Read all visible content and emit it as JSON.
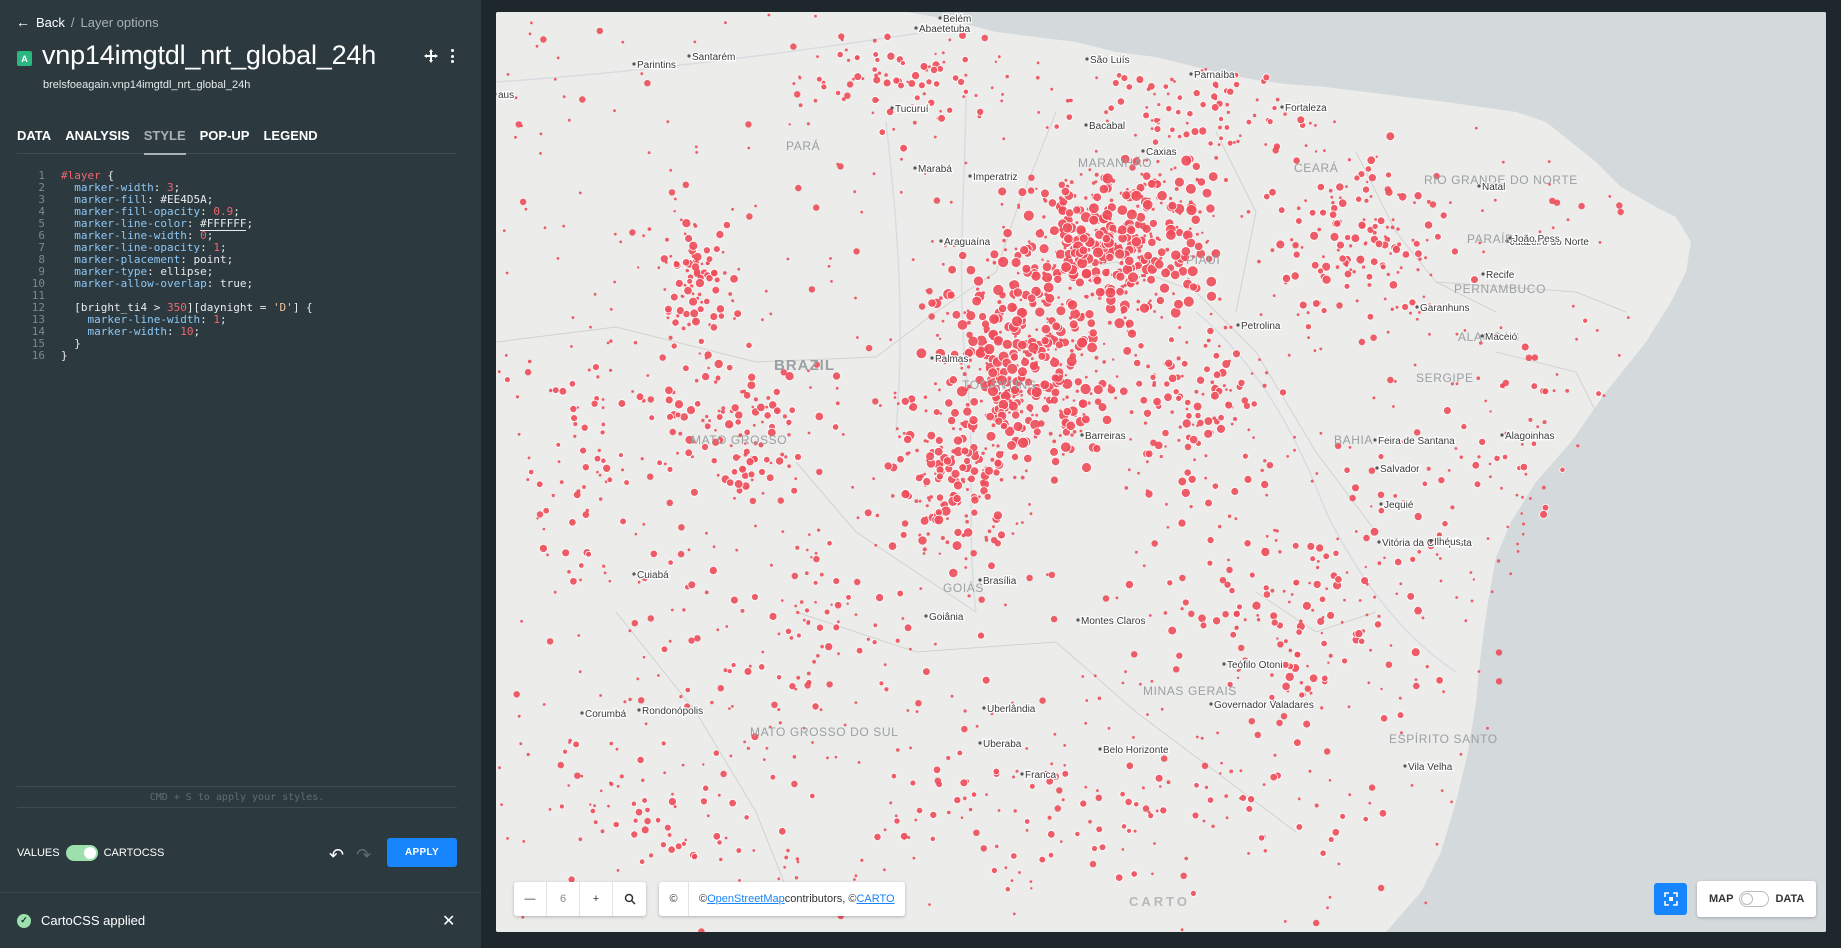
{
  "header": {
    "back_label": "Back",
    "breadcrumb": "Layer options",
    "layer_letter": "A",
    "layer_title": "vnp14imgtdl_nrt_global_24h",
    "layer_subtitle": "brelsfoeagain.vnp14imgtdl_nrt_global_24h"
  },
  "tabs": [
    {
      "label": "DATA"
    },
    {
      "label": "ANALYSIS"
    },
    {
      "label": "STYLE",
      "active": true
    },
    {
      "label": "POP-UP"
    },
    {
      "label": "LEGEND"
    }
  ],
  "code": [
    {
      "n": "1",
      "t": [
        [
          "sel",
          "#layer"
        ],
        [
          "pun",
          " {"
        ]
      ]
    },
    {
      "n": "2",
      "t": [
        [
          "pun",
          "  "
        ],
        [
          "prop",
          "marker-width"
        ],
        [
          "pun",
          ": "
        ],
        [
          "num",
          "3"
        ],
        [
          "pun",
          ";"
        ]
      ]
    },
    {
      "n": "3",
      "t": [
        [
          "pun",
          "  "
        ],
        [
          "prop",
          "marker-fill"
        ],
        [
          "pun",
          ": "
        ],
        [
          "pun",
          "#EE4D5A"
        ],
        [
          "pun",
          ";"
        ]
      ]
    },
    {
      "n": "4",
      "t": [
        [
          "pun",
          "  "
        ],
        [
          "prop",
          "marker-fill-opacity"
        ],
        [
          "pun",
          ": "
        ],
        [
          "num",
          "0.9"
        ],
        [
          "pun",
          ";"
        ]
      ]
    },
    {
      "n": "5",
      "t": [
        [
          "pun",
          "  "
        ],
        [
          "prop",
          "marker-line-color"
        ],
        [
          "pun",
          ": "
        ],
        [
          "color",
          "#FFFFFF"
        ],
        [
          "pun",
          ";"
        ]
      ]
    },
    {
      "n": "6",
      "t": [
        [
          "pun",
          "  "
        ],
        [
          "prop",
          "marker-line-width"
        ],
        [
          "pun",
          ": "
        ],
        [
          "num",
          "0"
        ],
        [
          "pun",
          ";"
        ]
      ]
    },
    {
      "n": "7",
      "t": [
        [
          "pun",
          "  "
        ],
        [
          "prop",
          "marker-line-opacity"
        ],
        [
          "pun",
          ": "
        ],
        [
          "num",
          "1"
        ],
        [
          "pun",
          ";"
        ]
      ]
    },
    {
      "n": "8",
      "t": [
        [
          "pun",
          "  "
        ],
        [
          "prop",
          "marker-placement"
        ],
        [
          "pun",
          ": point;"
        ]
      ]
    },
    {
      "n": "9",
      "t": [
        [
          "pun",
          "  "
        ],
        [
          "prop",
          "marker-type"
        ],
        [
          "pun",
          ": ellipse;"
        ]
      ]
    },
    {
      "n": "10",
      "t": [
        [
          "pun",
          "  "
        ],
        [
          "prop",
          "marker-allow-overlap"
        ],
        [
          "pun",
          ": true;"
        ]
      ]
    },
    {
      "n": "11",
      "t": []
    },
    {
      "n": "12",
      "t": [
        [
          "pun",
          "  [bright_ti4 > "
        ],
        [
          "num",
          "350"
        ],
        [
          "pun",
          "][daynight = "
        ],
        [
          "str",
          "'D'"
        ],
        [
          "pun",
          "] {"
        ]
      ]
    },
    {
      "n": "13",
      "t": [
        [
          "pun",
          "    "
        ],
        [
          "prop",
          "marker-line-width"
        ],
        [
          "pun",
          ": "
        ],
        [
          "num",
          "1"
        ],
        [
          "pun",
          ";"
        ]
      ]
    },
    {
      "n": "14",
      "t": [
        [
          "pun",
          "    "
        ],
        [
          "prop",
          "marker-width"
        ],
        [
          "pun",
          ": "
        ],
        [
          "num",
          "10"
        ],
        [
          "pun",
          ";"
        ]
      ]
    },
    {
      "n": "15",
      "t": [
        [
          "pun",
          "  }"
        ]
      ]
    },
    {
      "n": "16",
      "t": [
        [
          "pun",
          "}"
        ]
      ]
    }
  ],
  "editor_hint": "CMD + S to apply your styles.",
  "footer": {
    "values_label": "VALUES",
    "cartocss_label": "CARTOCSS",
    "cartocss_enabled": true,
    "apply_label": "APPLY"
  },
  "notification": {
    "text": "CartoCSS applied"
  },
  "map_controls": {
    "zoom_out": "—",
    "zoom_level": "6",
    "zoom_in": "+",
    "copyright_symbol": "©",
    "attribution_prefix": "© ",
    "osm_link": "OpenStreetMap",
    "attribution_mid": " contributors, © ",
    "carto_link": "CARTO",
    "carto_logo": "CARTO",
    "map_label": "MAP",
    "data_label": "DATA"
  },
  "colors": {
    "marker_fill": "#EE4D5A",
    "land": "#ececea",
    "sea": "#d4dadc",
    "accent": "#1785fb",
    "toggle_on": "#9de0ad"
  },
  "map_labels": [
    {
      "text": "Belém",
      "kind": "city"
    },
    {
      "text": "Abaetetuba",
      "kind": "city"
    },
    {
      "text": "Santarém",
      "kind": "city"
    },
    {
      "text": "Parintins",
      "kind": "city"
    },
    {
      "text": "São Luís",
      "kind": "city"
    },
    {
      "text": "Parnaíba",
      "kind": "city"
    },
    {
      "text": "Fortaleza",
      "kind": "city"
    },
    {
      "text": "Tucuruí",
      "kind": "city"
    },
    {
      "text": "Bacabal",
      "kind": "city"
    },
    {
      "text": "PARÁ",
      "kind": "state"
    },
    {
      "text": "MARANHÃO",
      "kind": "state"
    },
    {
      "text": "Caxias",
      "kind": "city"
    },
    {
      "text": "CEARÁ",
      "kind": "state"
    },
    {
      "text": "RIO GRANDE DO NORTE",
      "kind": "state"
    },
    {
      "text": "Marabá",
      "kind": "city"
    },
    {
      "text": "Imperatriz",
      "kind": "city"
    },
    {
      "text": "Natal",
      "kind": "city"
    },
    {
      "text": "Araguaína",
      "kind": "city"
    },
    {
      "text": "Juazeiro do Norte",
      "kind": "city"
    },
    {
      "text": "PARAÍBA",
      "kind": "state"
    },
    {
      "text": "João Pess",
      "kind": "city"
    },
    {
      "text": "PIAUÍ",
      "kind": "state"
    },
    {
      "text": "Recife",
      "kind": "city"
    },
    {
      "text": "PERNAMBUCO",
      "kind": "state"
    },
    {
      "text": "Garanhuns",
      "kind": "city"
    },
    {
      "text": "Petrolina",
      "kind": "city"
    },
    {
      "text": "ALAGOAS",
      "kind": "state"
    },
    {
      "text": "Maceió",
      "kind": "city"
    },
    {
      "text": "Palmas",
      "kind": "city"
    },
    {
      "text": "BRAZIL",
      "kind": "country"
    },
    {
      "text": "TOCANTINS",
      "kind": "state"
    },
    {
      "text": "SERGIPE",
      "kind": "state"
    },
    {
      "text": "MATO GROSSO",
      "kind": "state"
    },
    {
      "text": "Barreiras",
      "kind": "city"
    },
    {
      "text": "BAHIA",
      "kind": "state"
    },
    {
      "text": "Feira de Santana",
      "kind": "city"
    },
    {
      "text": "Alagoinhas",
      "kind": "city"
    },
    {
      "text": "Salvador",
      "kind": "city"
    },
    {
      "text": "Jequié",
      "kind": "city"
    },
    {
      "text": "Vitória da Conquista",
      "kind": "city"
    },
    {
      "text": "Ilhéus",
      "kind": "city"
    },
    {
      "text": "Cuiabá",
      "kind": "city"
    },
    {
      "text": "GOIÁS",
      "kind": "state"
    },
    {
      "text": "Brasília",
      "kind": "city"
    },
    {
      "text": "Goiânia",
      "kind": "city"
    },
    {
      "text": "Montes Claros",
      "kind": "city"
    },
    {
      "text": "Teófilo Otoni",
      "kind": "city"
    },
    {
      "text": "MINAS GERAIS",
      "kind": "state"
    },
    {
      "text": "Governador Valadares",
      "kind": "city"
    },
    {
      "text": "Rondonópolis",
      "kind": "city"
    },
    {
      "text": "Uberlândia",
      "kind": "city"
    },
    {
      "text": "MATO GROSSO DO SUL",
      "kind": "state"
    },
    {
      "text": "Uberaba",
      "kind": "city"
    },
    {
      "text": "Belo Horizonte",
      "kind": "city"
    },
    {
      "text": "ESPÍRITO SANTO",
      "kind": "state"
    },
    {
      "text": "Vila Velha",
      "kind": "city"
    },
    {
      "text": "Franca",
      "kind": "city"
    },
    {
      "text": "Corumbá",
      "kind": "city"
    },
    {
      "text": "aus",
      "kind": "city"
    }
  ]
}
